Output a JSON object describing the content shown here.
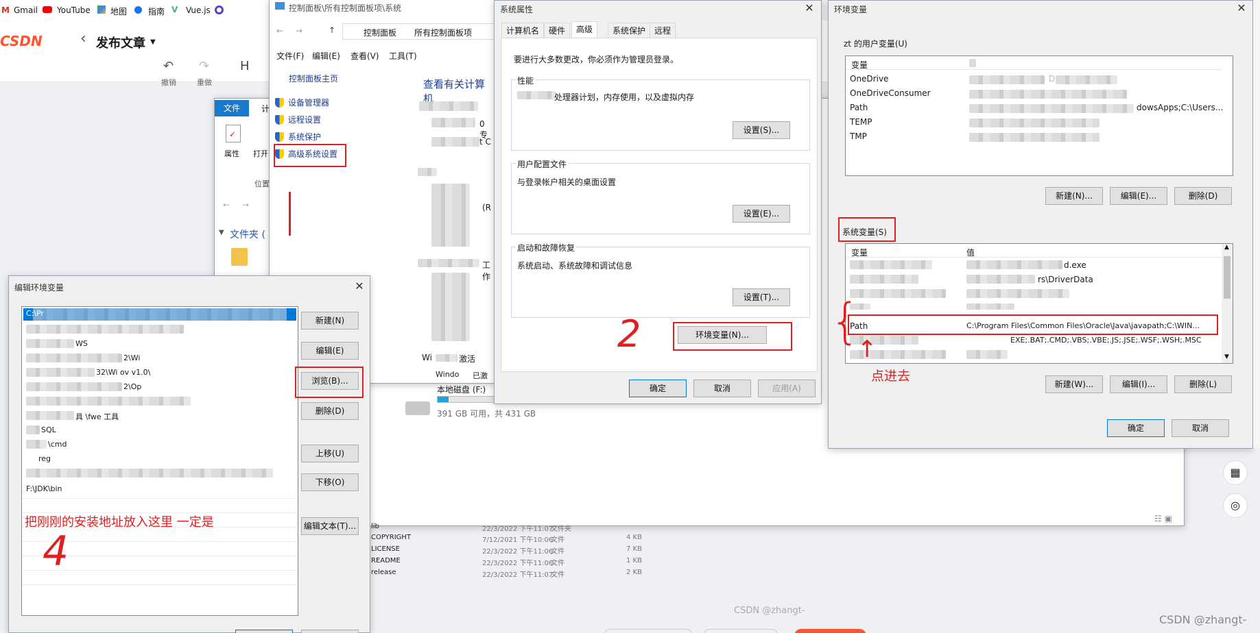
{
  "bookmarks": [
    {
      "icon": "gmail-icon",
      "label": "Gmail"
    },
    {
      "icon": "youtube-icon",
      "label": "YouTube"
    },
    {
      "icon": "maps-icon",
      "label": "地图"
    },
    {
      "icon": "guide-icon",
      "label": "指南"
    },
    {
      "icon": "vue-icon",
      "label": "Vue.js"
    }
  ],
  "csdn": {
    "logo": "CSDN",
    "back": "‹",
    "title": "发布文章",
    "undo": "撤销",
    "redo": "重做",
    "heading": "H",
    "watermark_mid": "CSDN @zhangt-",
    "watermark": "CSDN @zhangt-"
  },
  "explorer": {
    "tab_file": "文件",
    "tab_2": "计",
    "props": "属性",
    "open": "打开",
    "location": "位置",
    "folder": "文件夹 (",
    "files": [
      {
        "name": "lib",
        "date": "22/3/2022 下午11:07",
        "type": "文件夹",
        "size": ""
      },
      {
        "name": "COPYRIGHT",
        "date": "7/12/2021 下午10:06",
        "type": "文件",
        "size": "4 KB"
      },
      {
        "name": "LICENSE",
        "date": "22/3/2022 下午11:06",
        "type": "文件",
        "size": "7 KB"
      },
      {
        "name": "README",
        "date": "22/3/2022 下午11:06",
        "type": "文件",
        "size": "1 KB"
      },
      {
        "name": "release",
        "date": "22/3/2022 下午11:07",
        "type": "文件",
        "size": "2 KB"
      }
    ],
    "disk_name": "本地磁盘 (F:)",
    "disk_info": "391 GB 可用，共 431 GB"
  },
  "control_panel": {
    "title": "控制面板\\所有控制面板项\\系统",
    "crumbs": [
      "控制面板",
      "所有控制面板项",
      "系统"
    ],
    "menu": [
      "文件(F)",
      "编辑(E)",
      "查看(V)",
      "工具(T)"
    ],
    "home": "控制面板主页",
    "links": [
      "设备管理器",
      "远程设置",
      "系统保护",
      "高级系统设置"
    ],
    "heading": "查看有关计算机",
    "fragments": [
      "0 专",
      "t C",
      "(R",
      "工作",
      "Wi",
      "激活",
      "Windo",
      "已激"
    ]
  },
  "sysprops": {
    "title": "系统属性",
    "tabs": [
      "计算机名",
      "硬件",
      "高级",
      "系统保护",
      "远程"
    ],
    "admin_note": "要进行大多数更改，你必须作为管理员登录。",
    "perf_label": "性能",
    "perf_desc": "处理器计划，内存使用，以及虚拟内存",
    "perf_btn": "设置(S)...",
    "profile_label": "用户配置文件",
    "profile_desc": "与登录帐户相关的桌面设置",
    "profile_btn": "设置(E)...",
    "startup_label": "启动和故障恢复",
    "startup_desc": "系统启动、系统故障和调试信息",
    "startup_btn": "设置(T)...",
    "env_btn": "环境变量(N)...",
    "ok": "确定",
    "cancel": "取消",
    "apply": "应用(A)"
  },
  "envvars": {
    "title": "环境变量",
    "user_label": "zt 的用户变量(U)",
    "col_var": "变量",
    "col_val": "值",
    "user_vars": [
      {
        "name": "OneDrive",
        "value": "D"
      },
      {
        "name": "OneDriveConsumer",
        "value": ""
      },
      {
        "name": "Path",
        "value": "dowsApps;C:\\Users..."
      },
      {
        "name": "TEMP",
        "value": ""
      },
      {
        "name": "TMP",
        "value": ""
      }
    ],
    "user_new": "新建(N)...",
    "user_edit": "编辑(E)...",
    "user_del": "删除(D)",
    "sys_label": "系统变量(S)",
    "sys_partial": [
      "d.exe",
      "rs\\DriverData"
    ],
    "path_name": "Path",
    "path_value": "C:\\Program Files\\Common Files\\Oracle\\Java\\javapath;C:\\WIN...",
    "pathext_value": "EXE;.BAT;.CMD;.VBS;.VBE;.JS;.JSE;.WSF;.WSH;.MSC",
    "sys_new": "新建(W)...",
    "sys_edit": "编辑(I)...",
    "sys_del": "删除(L)",
    "ok": "确定",
    "cancel": "取消"
  },
  "editenv": {
    "title": "编辑环境变量",
    "items": [
      "C:\\Pr",
      "",
      "WS",
      "2\\Wi",
      "32\\Wi ov v1.0\\",
      "2\\Op",
      "",
      "具 \\fwe 工具",
      "SQL",
      "\\cmd",
      "reg",
      "",
      "F:\\JDK\\bin"
    ],
    "new": "新建(N)",
    "edit": "编辑(E)",
    "browse": "浏览(B)...",
    "delete": "删除(D)",
    "up": "上移(U)",
    "down": "下移(O)",
    "edit_text": "编辑文本(T)..."
  },
  "annotations": {
    "hint": "把刚刚的安装地址放入这里 一定是",
    "click": "点进去",
    "n2": "2",
    "n4": "4"
  }
}
